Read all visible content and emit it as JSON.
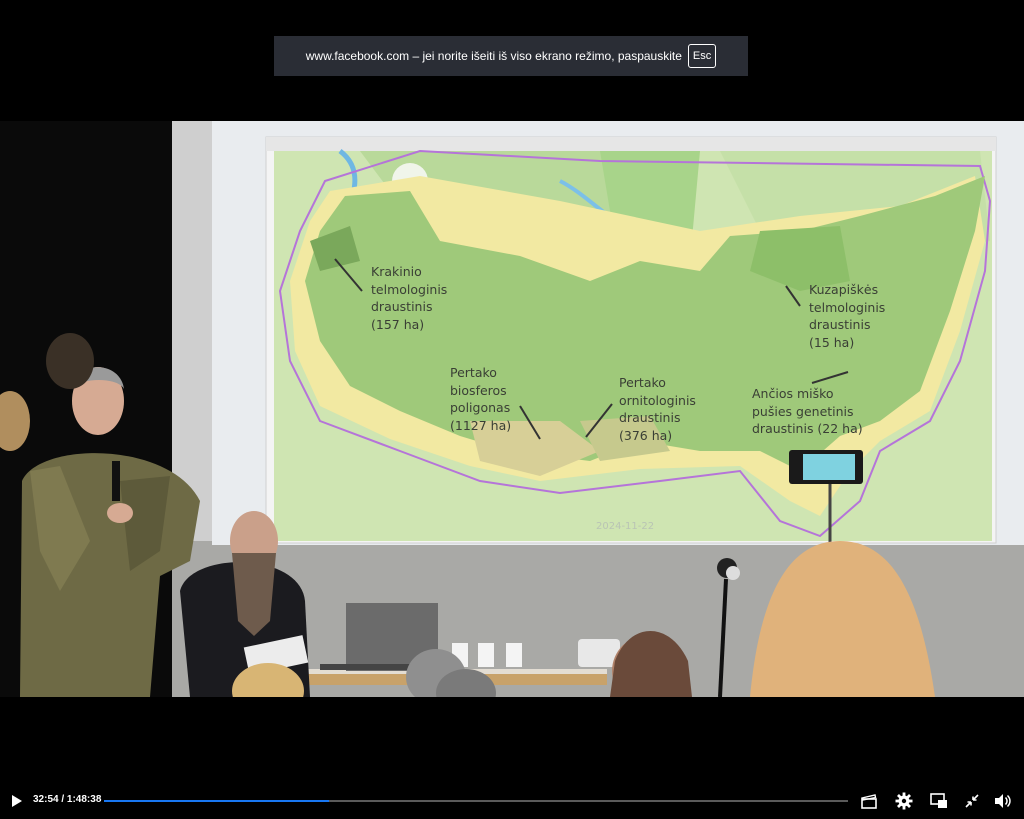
{
  "fullscreen_notice": {
    "text": "www.facebook.com – jei norite išeiti iš viso ekrano režimo, paspauskite",
    "key": "Esc"
  },
  "slide": {
    "date": "2024-11-22",
    "labels": [
      {
        "text": "Krakinio\ntelmologinis\ndraustinis\n(157 ha)"
      },
      {
        "text": "Pertako\nbiosferos\npoligonas\n(1127 ha)"
      },
      {
        "text": "Pertako\nornitologinis\ndraustinis\n(376 ha)"
      },
      {
        "text": "Kuzapiškės\ntelmologinis\ndraustinis\n(15 ha)"
      },
      {
        "text": "Ančios miško\npušies genetinis\ndraustinis (22 ha)"
      }
    ]
  },
  "player": {
    "current_time": "32:54",
    "duration": "1:48:38",
    "time_display": "32:54 / 1:48:38",
    "progress_fraction": 0.303,
    "accent_color": "#1877f2"
  }
}
